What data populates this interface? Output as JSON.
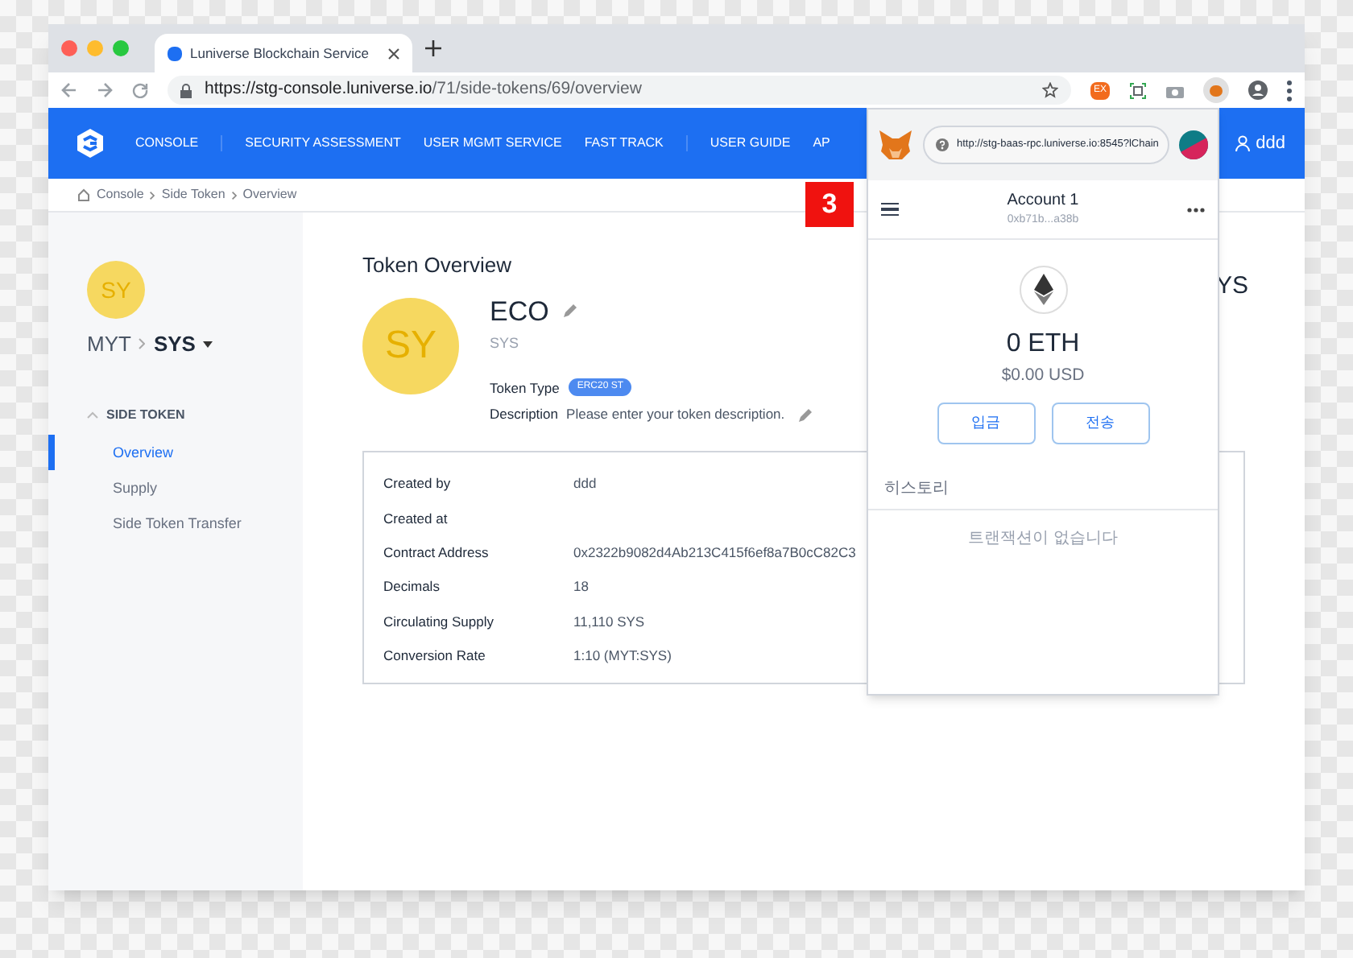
{
  "browser": {
    "tabs": [
      {
        "title": "Luniverse Blockchain Service",
        "selected": true
      }
    ],
    "url_host": "https://stg-console.luniverse.io",
    "url_path": "/71/side-tokens/69/overview",
    "extension_badge": "EX"
  },
  "nav": {
    "items": [
      {
        "label": "CONSOLE"
      },
      {
        "label": "SECURITY ASSESSMENT"
      },
      {
        "label": "USER MGMT SERVICE"
      },
      {
        "label": "FAST TRACK"
      },
      {
        "label": "USER GUIDE"
      },
      {
        "label": "AP"
      }
    ],
    "user": "ddd"
  },
  "breadcrumb": [
    "Console",
    "Side Token",
    "Overview"
  ],
  "sidebar": {
    "avatar": "SY",
    "parent": "MYT",
    "current": "SYS",
    "section": "SIDE TOKEN",
    "items": [
      {
        "label": "Overview",
        "selected": true
      },
      {
        "label": "Supply",
        "selected": false
      },
      {
        "label": "Side Token Transfer",
        "selected": false
      }
    ]
  },
  "main": {
    "title": "Token Overview",
    "avatar": "SY",
    "name": "ECO",
    "symbol": "SYS",
    "token_type_label": "Token Type",
    "token_type": "ERC20 ST",
    "description_label": "Description",
    "description": "Please enter your token description.",
    "balance_fragment": "YS",
    "details": [
      {
        "label": "Created by",
        "value": "ddd"
      },
      {
        "label": "Created at"
      },
      {
        "label": "Contract Address",
        "value": "0x2322b9082d4Ab213C415f6ef8a7B0cC82C3"
      },
      {
        "label": "Decimals",
        "value": "18"
      },
      {
        "label": "Circulating Supply",
        "value": "11,110 SYS"
      },
      {
        "label": "Conversion Rate",
        "value": "1:10 (MYT:SYS)"
      }
    ]
  },
  "step_badge": "3",
  "wallet": {
    "url": "http://stg-baas-rpc.luniverse.io:8545?lChain",
    "account": "Account 1",
    "address": "0xb71b...a38b",
    "balance": "0 ETH",
    "usd": "$0.00 USD",
    "buttons": [
      "입금",
      "전송"
    ],
    "history_label": "히스토리",
    "empty": "트랜잭션이 없습니다"
  }
}
